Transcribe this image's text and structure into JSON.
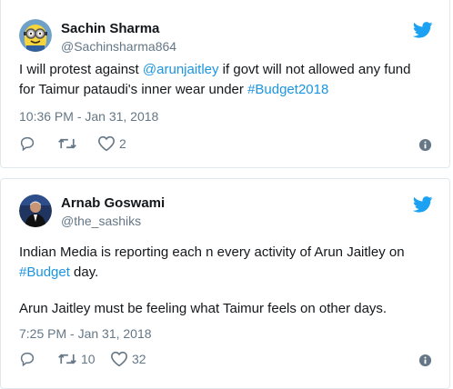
{
  "tweets": [
    {
      "name": "Sachin Sharma",
      "handle": "@Sachinsharma864",
      "text_part1": "I will protest against ",
      "mention": "@arunjaitley",
      "text_part2": " if govt will not allowed any fund for Taimur pataudi's inner wear under ",
      "hashtag": "#Budget2018",
      "timestamp": "10:36 PM - Jan 31, 2018",
      "retweet_count": "",
      "like_count": "2"
    },
    {
      "name": "Arnab Goswami",
      "handle": "@the_sashiks",
      "text_part1": "Indian Media is reporting each n every activity of Arun Jaitley on ",
      "hashtag": "#Budget",
      "text_part2": " day.",
      "text_part3": "Arun Jaitley must be feeling what Taimur feels on other days.",
      "timestamp": "7:25 PM - Jan 31, 2018",
      "retweet_count": "10",
      "like_count": "32"
    }
  ],
  "colors": {
    "link": "#1b95e0",
    "twitter_blue": "#1da1f2",
    "secondary": "#657786"
  },
  "icons": [
    "twitter-bird-icon",
    "reply-icon",
    "retweet-icon",
    "heart-icon",
    "info-icon"
  ]
}
